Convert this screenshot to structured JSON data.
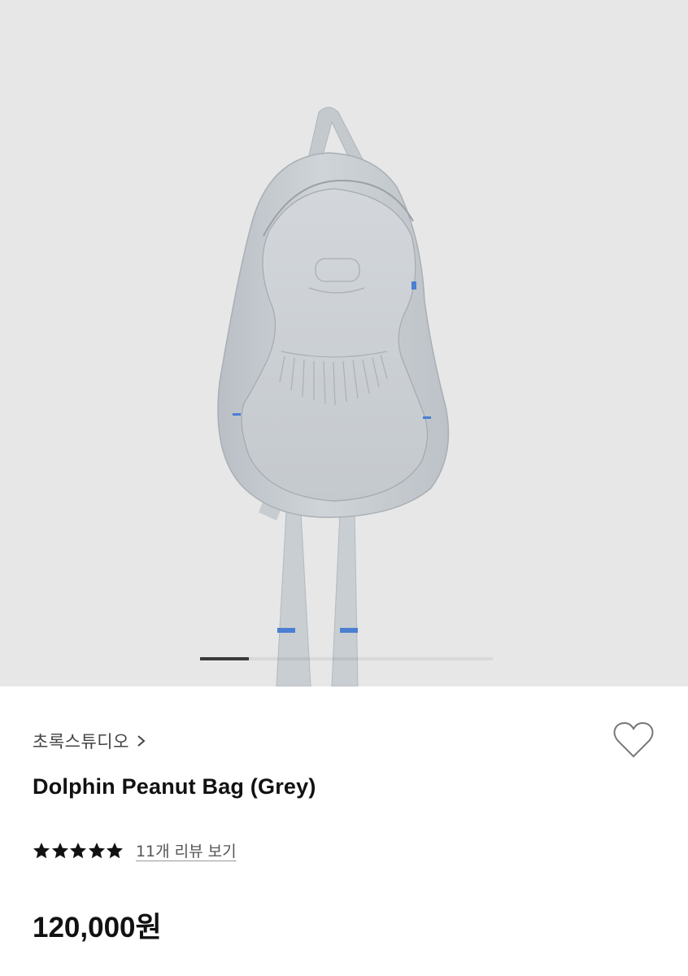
{
  "gallery": {
    "image_alt": "Dolphin Peanut Bag (Grey) product photo",
    "slide_count": 6,
    "active_slide": 1,
    "background_color": "#e7e7e7",
    "bag_color": "#c9ced3",
    "accent_color": "#4a7fd1"
  },
  "product": {
    "brand": "초록스튜디오",
    "brand_icon": "chevron-right-icon",
    "name": "Dolphin Peanut Bag (Grey)",
    "wishlist_icon": "heart-outline-icon",
    "rating": 5,
    "max_rating": 5,
    "review_link": "11개 리뷰 보기",
    "price": "120,000원"
  }
}
